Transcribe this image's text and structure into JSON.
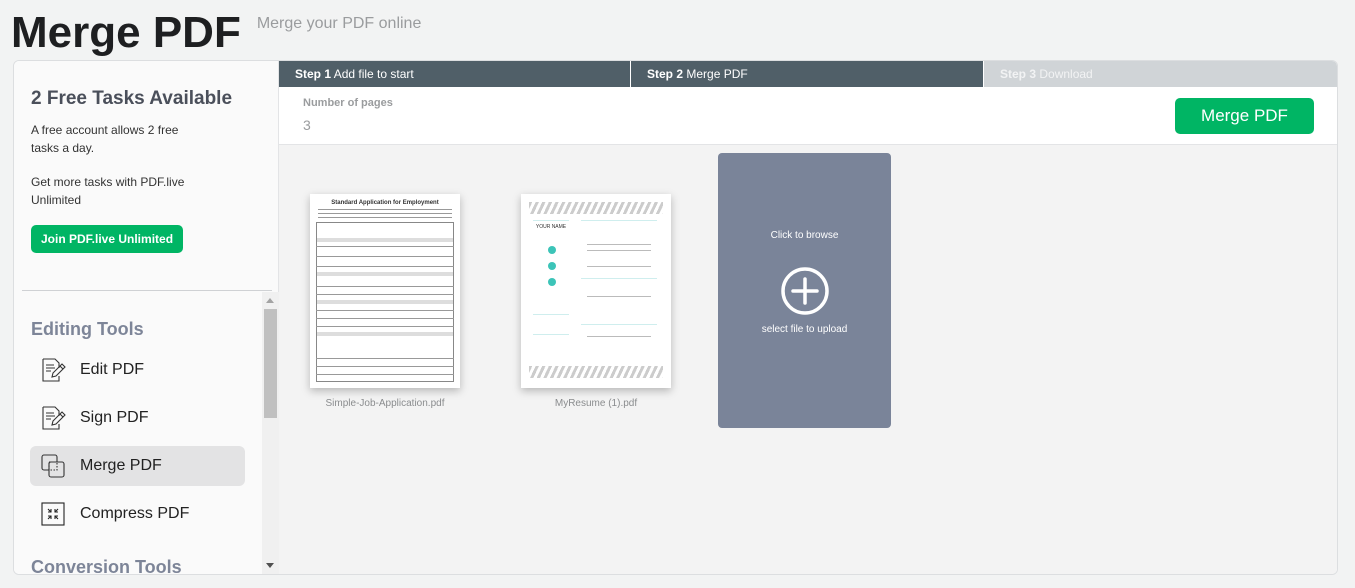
{
  "header": {
    "title": "Merge PDF",
    "subtitle": "Merge your PDF online"
  },
  "promo": {
    "title": "2 Free Tasks Available",
    "text1": "A free account allows 2 free tasks a day.",
    "text2": "Get more tasks with PDF.live Unlimited",
    "button": "Join PDF.live Unlimited"
  },
  "sidebar": {
    "sections": [
      {
        "heading": "Editing Tools",
        "items": [
          {
            "label": "Edit PDF",
            "icon": "edit-document-icon",
            "active": false
          },
          {
            "label": "Sign PDF",
            "icon": "sign-document-icon",
            "active": false
          },
          {
            "label": "Merge PDF",
            "icon": "merge-icon",
            "active": true
          },
          {
            "label": "Compress PDF",
            "icon": "compress-icon",
            "active": false
          }
        ]
      },
      {
        "heading": "Conversion Tools",
        "items": []
      }
    ]
  },
  "steps": [
    {
      "number": "Step 1",
      "label": "Add file to start",
      "state": "done"
    },
    {
      "number": "Step 2",
      "label": "Merge PDF",
      "state": "current"
    },
    {
      "number": "Step 3",
      "label": "Download",
      "state": "pending"
    }
  ],
  "toolbar": {
    "pages_label": "Number of pages",
    "pages_value": "3",
    "merge_button": "Merge PDF"
  },
  "files": [
    {
      "name": "Simple-Job-Application.pdf",
      "thumb_title": "Standard Application for Employment"
    },
    {
      "name": "MyResume (1).pdf",
      "thumb_title": "YOUR NAME"
    }
  ],
  "upload": {
    "top_text": "Click to browse",
    "bottom_text": "select file to upload"
  },
  "colors": {
    "accent_green": "#00b564",
    "step_active": "#505f68",
    "step_pending": "#d0d4d7",
    "upload_bg": "#7a8499",
    "heading_muted": "#7d8598"
  }
}
